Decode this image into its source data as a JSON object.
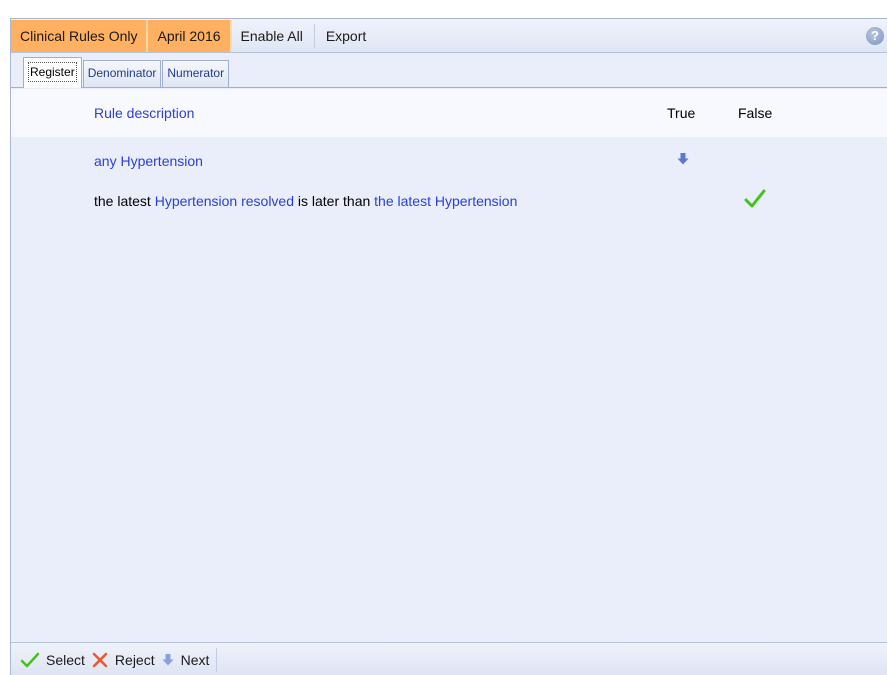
{
  "toolbar": {
    "clinical_rules_label": "Clinical Rules Only",
    "period_label": "April 2016",
    "enable_all_label": "Enable All",
    "export_label": "Export",
    "help_symbol": "?"
  },
  "tabs": [
    {
      "label": "Register",
      "active": true
    },
    {
      "label": "Denominator",
      "active": false
    },
    {
      "label": "Numerator",
      "active": false
    }
  ],
  "table": {
    "headers": {
      "description": "Rule description",
      "true": "True",
      "false": "False"
    },
    "rows": [
      {
        "segments": [
          {
            "text": "any Hypertension",
            "link": true
          }
        ],
        "true_icon": "down-arrow-icon",
        "false_icon": null
      },
      {
        "segments": [
          {
            "text": "the latest ",
            "link": false
          },
          {
            "text": "Hypertension resolved",
            "link": true
          },
          {
            "text": " is later than ",
            "link": false
          },
          {
            "text": "the latest Hypertension",
            "link": true
          }
        ],
        "true_icon": null,
        "false_icon": "checkmark-icon"
      }
    ]
  },
  "statusbar": {
    "select_label": "Select",
    "reject_label": "Reject",
    "next_label": "Next"
  },
  "colors": {
    "highlight": "#ffb060",
    "link": "#2a3fd8",
    "check": "#45c21a",
    "arrow": "#5a78d6",
    "reject": "#f0552a"
  }
}
